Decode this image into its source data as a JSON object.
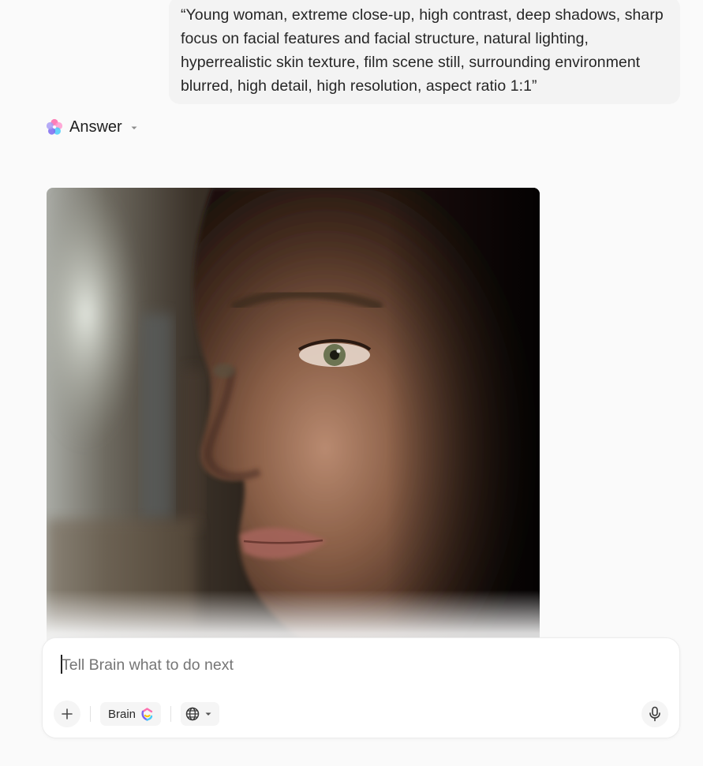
{
  "prompt": {
    "text": "“Young woman, extreme close-up, high contrast, deep shadows, sharp focus on facial features and facial structure, natural lighting, hyperrealistic skin texture, film scene still, surrounding environment blurred, high detail, high resolution, aspect ratio 1:1”"
  },
  "answer": {
    "label": "Answer",
    "logo_icon": "brain-flower-logo-icon",
    "dropdown_icon": "caret-down-icon"
  },
  "generated_image": {
    "subject": "photo-close-up-of-young-woman-face"
  },
  "composer": {
    "placeholder": "Tell Brain what to do next",
    "value": "",
    "add_icon": "plus-icon",
    "model_label": "Brain",
    "model_icon": "brain-logo-icon",
    "web_icon": "globe-icon",
    "web_dropdown_icon": "caret-down-icon",
    "mic_icon": "microphone-icon"
  },
  "colors": {
    "background": "#fafafa",
    "bubble": "#f3f3f3",
    "composer": "#ffffff",
    "brand_purple": "#7b68ee",
    "brand_pink": "#fd71af",
    "brand_blue": "#49ccf9",
    "brand_yellow": "#ffc800"
  }
}
